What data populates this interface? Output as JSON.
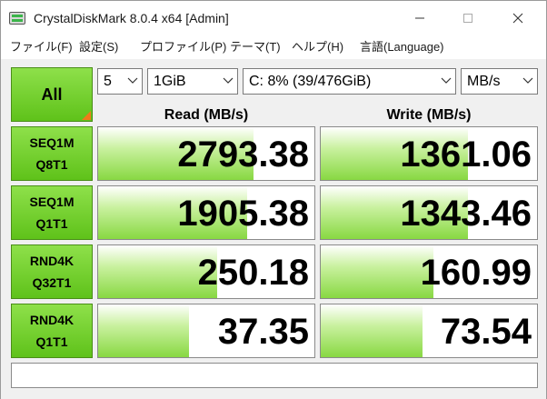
{
  "window": {
    "title": "CrystalDiskMark 8.0.4 x64 [Admin]",
    "icon": "app-icon"
  },
  "menu": [
    {
      "label": "ファイル(F)"
    },
    {
      "label": "設定(S)"
    },
    {
      "label": "プロファイル(P)"
    },
    {
      "label": "テーマ(T)"
    },
    {
      "label": "ヘルプ(H)"
    },
    {
      "label": "言語(Language)"
    }
  ],
  "controls": {
    "all_label": "All",
    "count": "5",
    "size": "1GiB",
    "drive": "C: 8% (39/476GiB)",
    "unit": "MB/s"
  },
  "columns": {
    "read": "Read (MB/s)",
    "write": "Write (MB/s)"
  },
  "rows": [
    {
      "line1": "SEQ1M",
      "line2": "Q8T1",
      "read": "2793.38",
      "write": "1361.06",
      "read_level": 0.72,
      "write_level": 0.68
    },
    {
      "line1": "SEQ1M",
      "line2": "Q1T1",
      "read": "1905.38",
      "write": "1343.46",
      "read_level": 0.69,
      "write_level": 0.68
    },
    {
      "line1": "RND4K",
      "line2": "Q32T1",
      "read": "250.18",
      "write": "160.99",
      "read_level": 0.55,
      "write_level": 0.52
    },
    {
      "line1": "RND4K",
      "line2": "Q1T1",
      "read": "37.35",
      "write": "73.54",
      "read_level": 0.42,
      "write_level": 0.47
    }
  ],
  "status": "",
  "colors": {
    "accent_green": "#6fd02a",
    "bar_green": "#88d842",
    "corner_orange": "#f07a1a"
  }
}
